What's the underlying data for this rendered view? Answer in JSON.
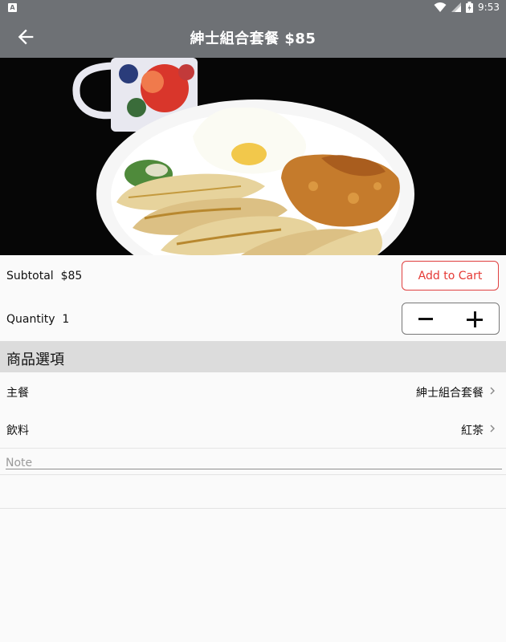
{
  "status_bar": {
    "app_badge": "A",
    "time": "9:53"
  },
  "app_bar": {
    "title": "紳士組合套餐 $85"
  },
  "item": {
    "subtotal_label": "Subtotal",
    "subtotal_value": "$85",
    "add_to_cart": "Add to Cart",
    "quantity_label": "Quantity",
    "quantity_value": "1"
  },
  "options": {
    "section_title": "商品選項",
    "rows": [
      {
        "name": "主餐",
        "value": "紳士組合套餐"
      },
      {
        "name": "飲料",
        "value": "紅茶"
      }
    ]
  },
  "note": {
    "placeholder": "Note"
  },
  "colors": {
    "app_bar": "#6e7175",
    "accent": "#e53935",
    "section": "#dcdcdc"
  }
}
